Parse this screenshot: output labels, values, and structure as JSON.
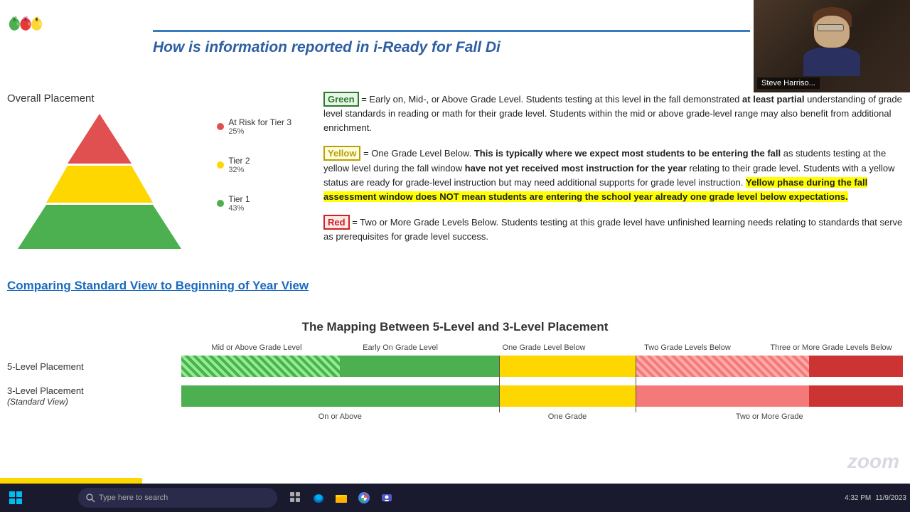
{
  "header": {
    "title": "How is information reported in i-Ready for Fall Di"
  },
  "presenter": {
    "name": "Steve Harriso..."
  },
  "left": {
    "overall_placement": "Overall Placement",
    "legend": [
      {
        "label": "At Risk for Tier 3",
        "percent": "25%",
        "color": "#e05050"
      },
      {
        "label": "Tier 2",
        "percent": "32%",
        "color": "#ffd700"
      },
      {
        "label": "Tier 1",
        "percent": "43%",
        "color": "#4caf50"
      }
    ],
    "comparing_link": "Comparing Standard View to Beginning of Year View"
  },
  "definitions": [
    {
      "color_label": "Green",
      "color_class": "green-label",
      "text_parts": [
        {
          "type": "normal",
          "text": " = Early on, Mid-, or Above Grade Level. Students testing at this level in the fall demonstrated "
        },
        {
          "type": "bold",
          "text": "at least partial"
        },
        {
          "type": "normal",
          "text": " understanding of grade level standards in reading or math for their grade level. Students within the mid or above grade-level range may also benefit from additional enrichment."
        }
      ]
    },
    {
      "color_label": "Yellow",
      "color_class": "yellow-label",
      "text_intro": " = One Grade Level Below. ",
      "bold_text": "This is typically where we expect most students to be entering the fall",
      "text_mid": " as students testing at the yellow level during the fall window ",
      "bold_text2": "have not yet received most instruction for the year",
      "text_end": " relating to their grade level. Students with a yellow status are ready for grade-level instruction but may need additional supports for grade level instruction. ",
      "highlight_text": "Yellow phase during the fall assessment window does NOT mean students are entering the school year already one grade level below expectations."
    },
    {
      "color_label": "Red",
      "color_class": "red-label",
      "text": " = Two or More Grade Levels Below. Students testing at this grade level have unfinished learning needs relating to standards that serve as prerequisites for grade level success."
    }
  ],
  "mapping": {
    "title": "The Mapping Between 5-Level and 3-Level Placement",
    "headers": [
      "Mid or Above Grade Level",
      "Early On Grade Level",
      "One Grade Level Below",
      "Two Grade Levels Below",
      "Three or More Grade Levels Below"
    ],
    "rows": [
      {
        "label": "5-Level Placement",
        "sublabel": ""
      },
      {
        "label": "3-Level Placement",
        "sublabel": "(Standard View)"
      }
    ],
    "bottom_labels": [
      "On or Above",
      "One Grade",
      "Two or More Grade"
    ]
  },
  "taskbar": {
    "search_placeholder": "Type here to search",
    "time": "4:32 PM",
    "date": "11/9/2023"
  },
  "zoom_watermark": "zoom"
}
